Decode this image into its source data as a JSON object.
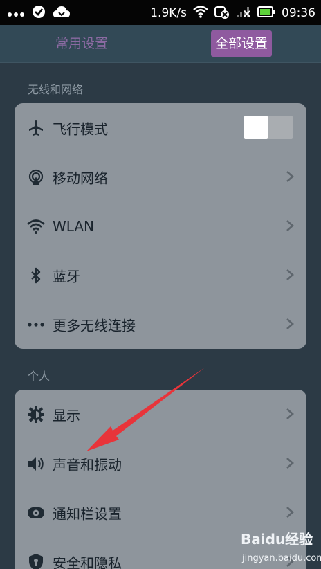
{
  "status_bar": {
    "speed": "1.9K/s",
    "time": "09:36",
    "icons": [
      "more-dots-icon",
      "check-circle-icon",
      "cloud-icon",
      "wifi-icon",
      "alarm-off-icon",
      "signal-icon",
      "battery-charging-icon"
    ]
  },
  "tabs": [
    {
      "label": "常用设置",
      "selected": false
    },
    {
      "label": "全部设置",
      "selected": true
    }
  ],
  "sections": [
    {
      "title": "无线和网络",
      "items": [
        {
          "label": "飞行模式",
          "icon": "airplane-icon",
          "control": "toggle",
          "toggle_on": false
        },
        {
          "label": "移动网络",
          "icon": "mobile-network-icon",
          "control": "chevron"
        },
        {
          "label": "WLAN",
          "icon": "wifi-icon",
          "control": "chevron"
        },
        {
          "label": "蓝牙",
          "icon": "bluetooth-icon",
          "control": "chevron"
        },
        {
          "label": "更多无线连接",
          "icon": "more-dots-icon",
          "control": "chevron"
        }
      ]
    },
    {
      "title": "个人",
      "items": [
        {
          "label": "显示",
          "icon": "display-gear-icon",
          "control": "chevron"
        },
        {
          "label": "声音和振动",
          "icon": "speaker-icon",
          "control": "chevron"
        },
        {
          "label": "通知栏设置",
          "icon": "notification-eye-icon",
          "control": "chevron"
        },
        {
          "label": "安全和隐私",
          "icon": "shield-icon",
          "control": "chevron"
        }
      ]
    }
  ],
  "watermark": {
    "brand": "Baidu经验",
    "url": "jingyan.baidu.com"
  },
  "colors": {
    "background": "#2c3a45",
    "card": "#8e959c",
    "accent_purple": "#8f5a9f",
    "annotation_red": "#e8343a"
  }
}
